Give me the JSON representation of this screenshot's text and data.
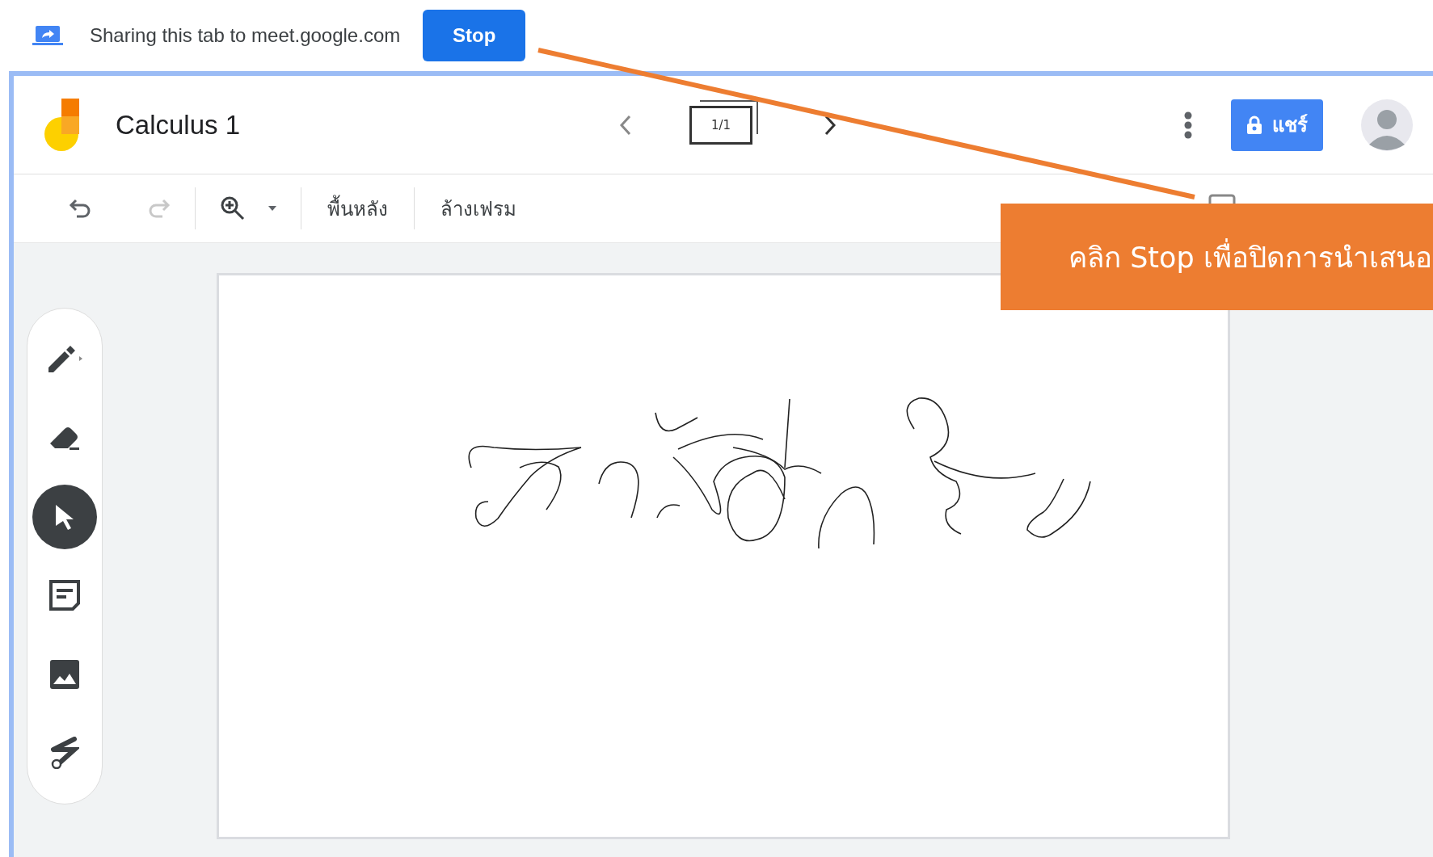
{
  "share_bar": {
    "message": "Sharing this tab to meet.google.com",
    "stop_button": "Stop"
  },
  "header": {
    "title": "Calculus 1",
    "frame_counter": "1/1",
    "share_button": "แชร์"
  },
  "toolbar": {
    "undo": {
      "disabled": false
    },
    "redo": {
      "disabled": true
    },
    "background_button": "พื้นหลัง",
    "clear_frame_button": "ล้างเฟรม"
  },
  "tools": [
    {
      "kind": "pen",
      "selected": false
    },
    {
      "kind": "eraser",
      "selected": false
    },
    {
      "kind": "select",
      "selected": true
    },
    {
      "kind": "sticky_note",
      "selected": false
    },
    {
      "kind": "image",
      "selected": false
    },
    {
      "kind": "laser",
      "selected": false
    }
  ],
  "callout": {
    "text": "คลิก Stop เพื่อปิดการนำเสนอ"
  }
}
